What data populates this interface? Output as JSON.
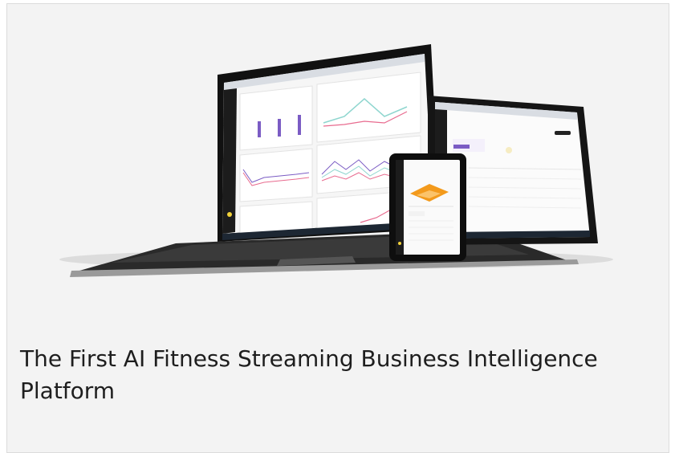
{
  "caption": {
    "title": "The First AI Fitness Streaming Business Intelligence Platform"
  },
  "colors": {
    "background": "#f3f3f3",
    "accent_purple": "#7b5cc4",
    "accent_orange": "#f39a1c",
    "dark_sidebar": "#1c1c1c"
  },
  "devices": {
    "laptop": "laptop-mockup",
    "tablet": "tablet-mockup",
    "phone": "phone-mockup"
  }
}
